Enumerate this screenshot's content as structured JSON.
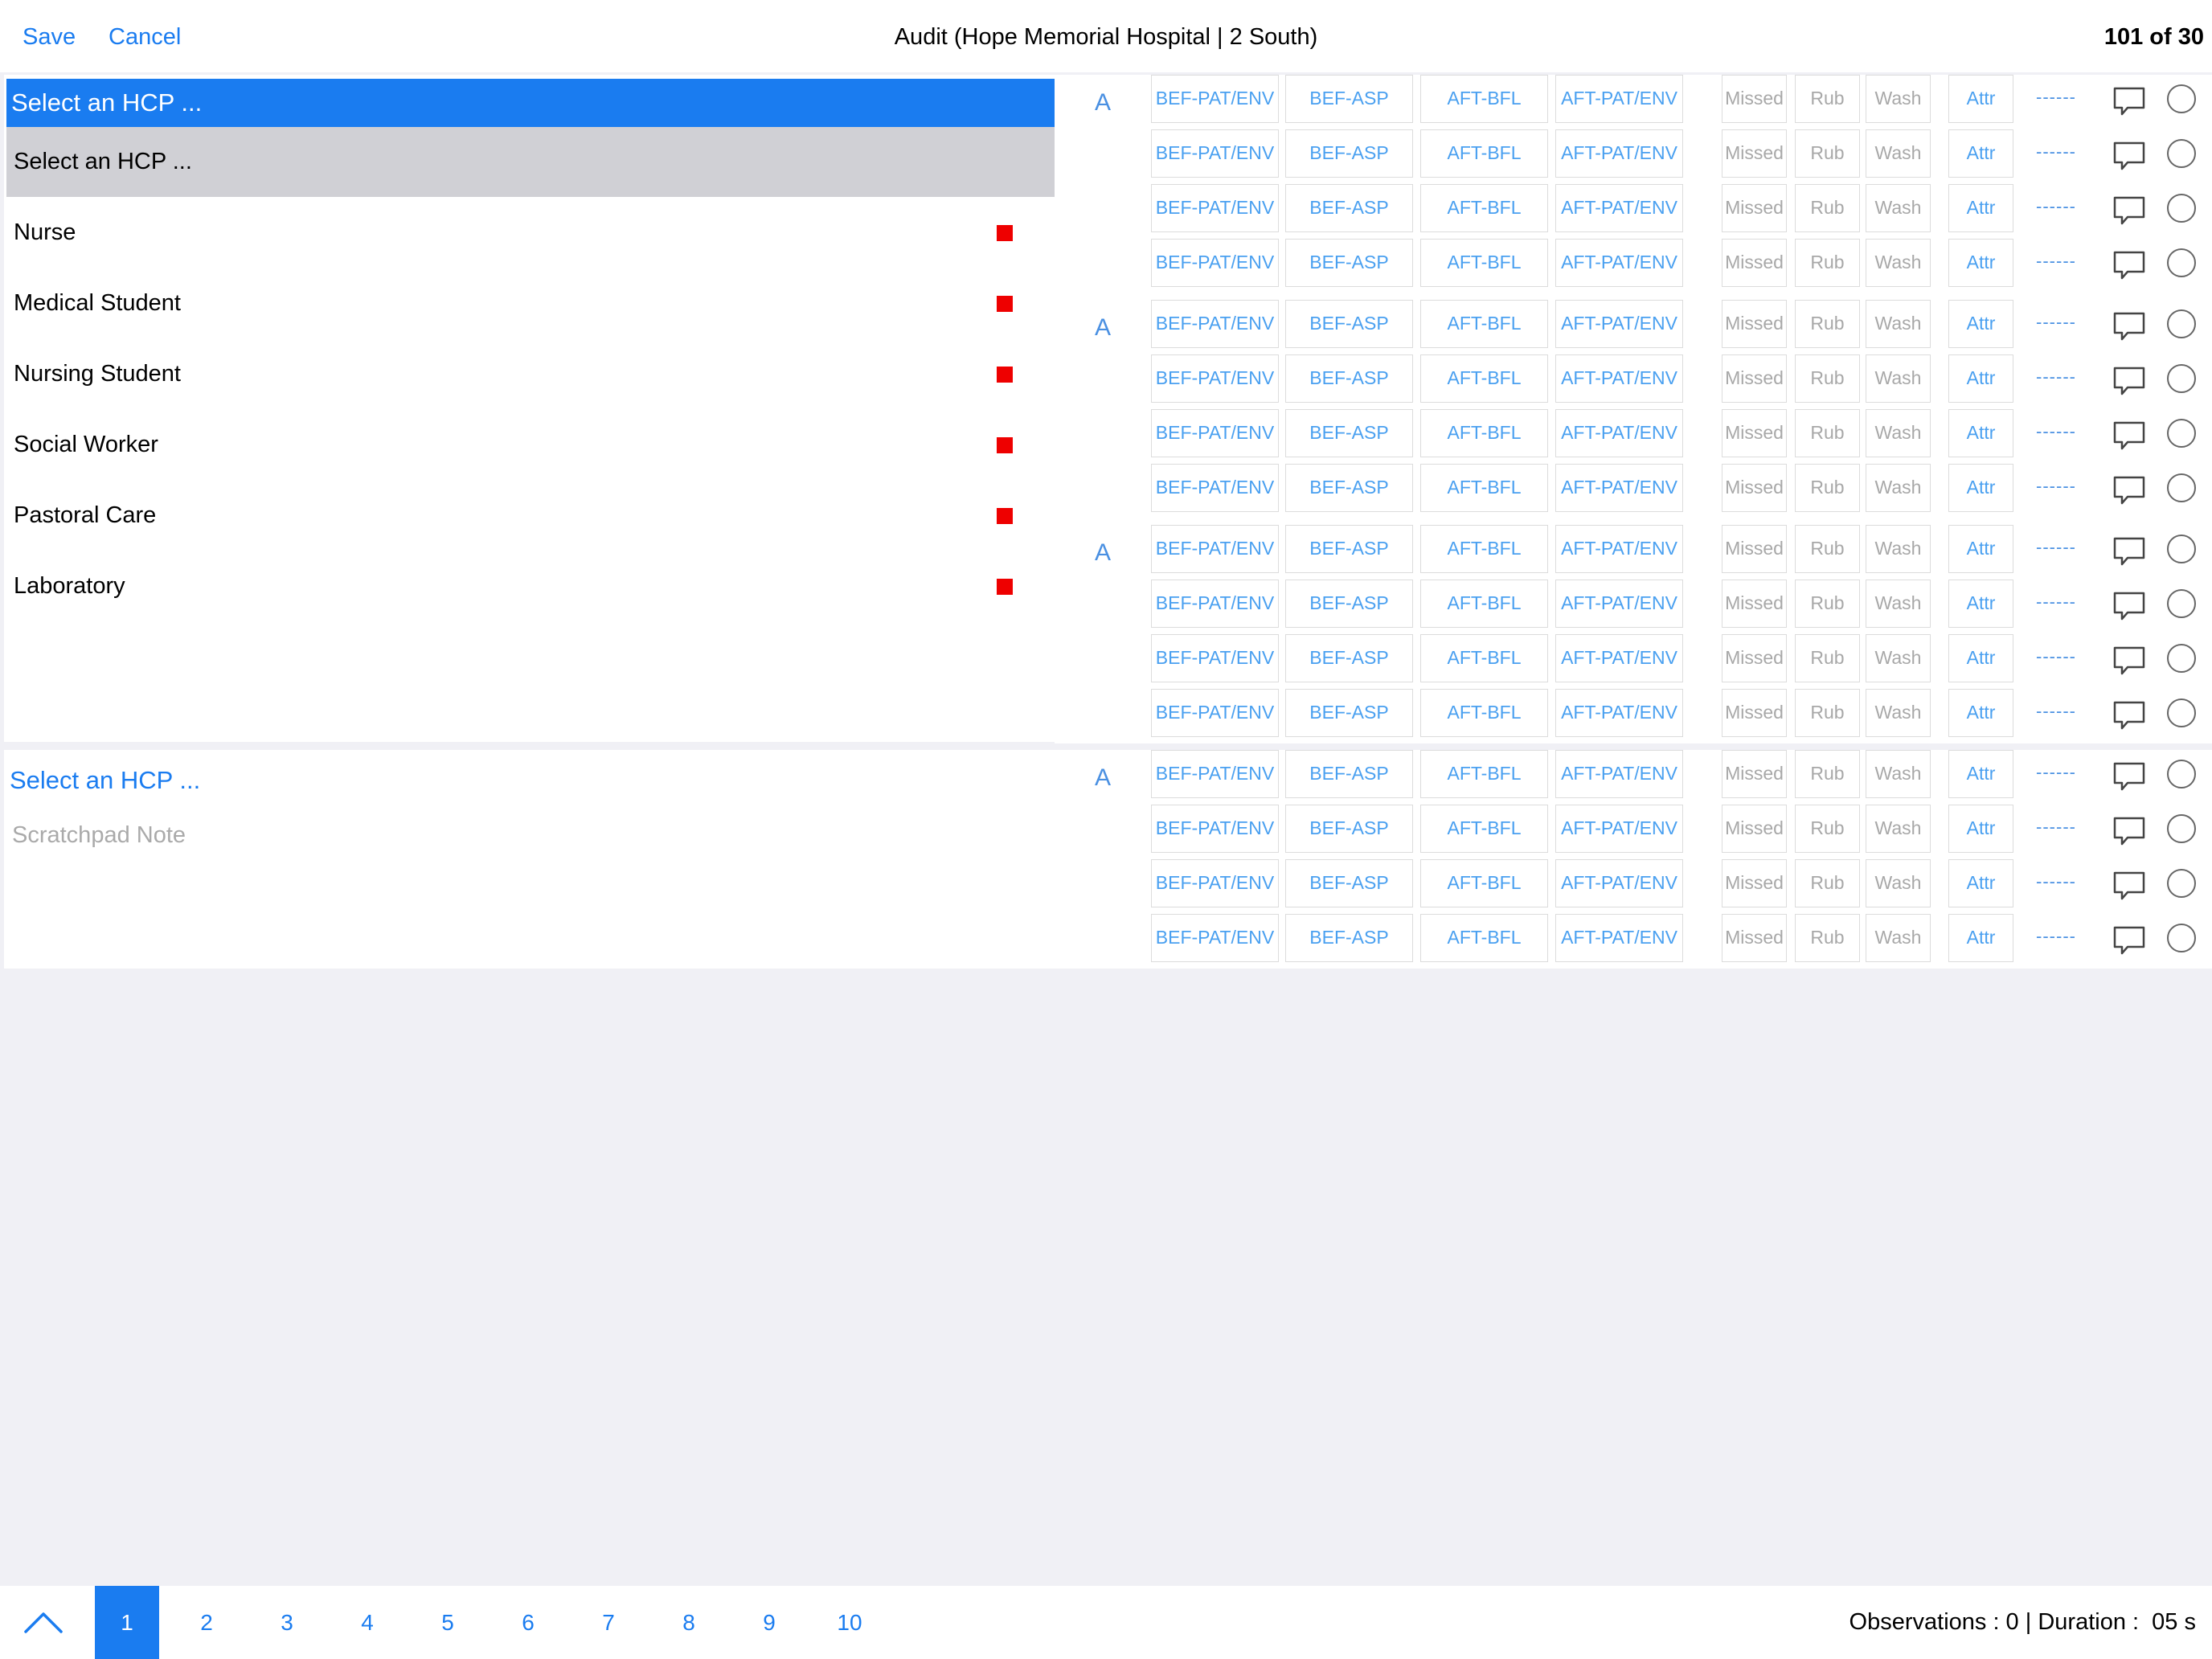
{
  "header": {
    "save_label": "Save",
    "cancel_label": "Cancel",
    "title": "Audit (Hope Memorial Hospital | 2 South)",
    "counter": "101 of 30"
  },
  "hcp": {
    "selected": "Select an HCP ...",
    "prompt": "Select an HCP ...",
    "options": [
      "Nurse",
      "Medical Student",
      "Nursing Student",
      "Social Worker",
      "Pastoral Care",
      "Laboratory"
    ],
    "marker_color": "#ee0000"
  },
  "second_group": {
    "hcp_label": "Select an HCP ...",
    "scratchpad_placeholder": "Scratchpad Note"
  },
  "block_label": "A",
  "row_cells": {
    "opportunities": [
      "BEF-PAT/ENV",
      "BEF-ASP",
      "AFT-BFL",
      "AFT-PAT/ENV"
    ],
    "actions": [
      "Missed",
      "Rub",
      "Wash"
    ],
    "attr": "Attr",
    "dash": "------"
  },
  "icons": {
    "comment": "speech-bubble-icon",
    "select": "empty-circle-icon",
    "up": "chevron-up-icon"
  },
  "colors": {
    "accent": "#1a7cf0",
    "marker": "#ee0000",
    "cell_text": "#4aa0f0",
    "muted_text": "#a8a8a8"
  },
  "footer": {
    "pages": [
      "1",
      "2",
      "3",
      "4",
      "5",
      "6",
      "7",
      "8",
      "9",
      "10"
    ],
    "active_page": "1",
    "status": "Observations : 0 | Duration :  05 s"
  }
}
